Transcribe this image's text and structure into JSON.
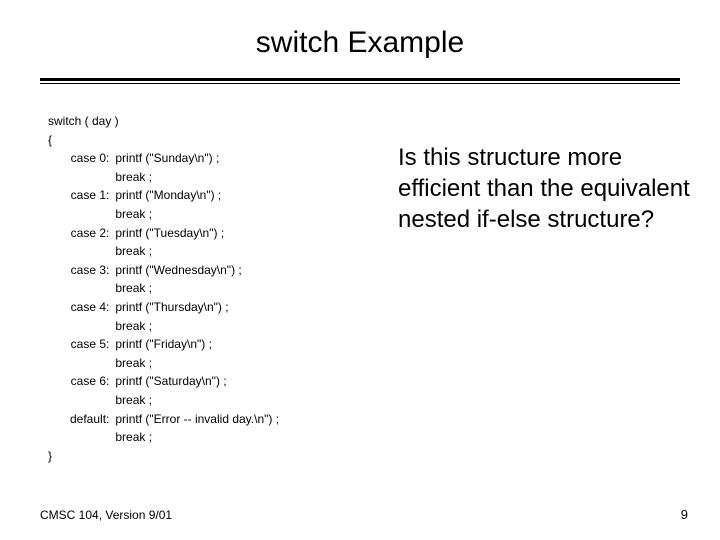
{
  "title": "switch Example",
  "code": {
    "header": "switch ( day )",
    "open_brace": "{",
    "close_brace": "}",
    "break_stmt": "break ;",
    "cases": [
      {
        "label": "case 0:",
        "stmt": "printf (\"Sunday\\n\") ;"
      },
      {
        "label": "case 1:",
        "stmt": "printf (\"Monday\\n\") ;"
      },
      {
        "label": "case 2:",
        "stmt": "printf (\"Tuesday\\n\") ;"
      },
      {
        "label": "case 3:",
        "stmt": "printf (\"Wednesday\\n\") ;"
      },
      {
        "label": "case 4:",
        "stmt": "printf (\"Thursday\\n\") ;"
      },
      {
        "label": "case 5:",
        "stmt": "printf (\"Friday\\n\") ;"
      },
      {
        "label": "case 6:",
        "stmt": "printf (\"Saturday\\n\") ;"
      },
      {
        "label": "default:",
        "stmt": "printf (\"Error -- invalid day.\\n\") ;"
      }
    ]
  },
  "question": "Is this structure more efficient than the equivalent nested if-else structure?",
  "footer_left": "CMSC 104, Version 9/01",
  "footer_right": "9"
}
